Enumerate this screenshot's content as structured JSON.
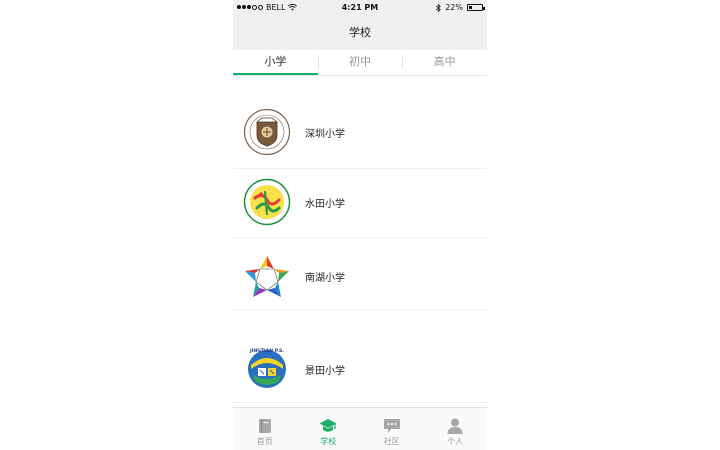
{
  "status_bar": {
    "carrier": "BELL",
    "time": "4:21 PM",
    "battery": "22%",
    "battery_level": 0.22,
    "signal_bars": 3
  },
  "nav": {
    "title": "学校"
  },
  "tabs": [
    {
      "label": "小学",
      "active": true
    },
    {
      "label": "初中",
      "active": false
    },
    {
      "label": "高中",
      "active": false
    }
  ],
  "schools": [
    {
      "name": "深圳小学",
      "logo": "shenzhen-school-crest-logo"
    },
    {
      "name": "水田小学",
      "logo": "shuitian-school-circle-logo"
    },
    {
      "name": "南湖小学",
      "logo": "nanhu-school-star-logo"
    },
    {
      "name": "景田小学",
      "logo": "jingtian-school-logo",
      "logo_text": "JINGTIAN P.S."
    }
  ],
  "tab_bar": [
    {
      "label": "首页",
      "icon": "book-icon",
      "active": false
    },
    {
      "label": "学校",
      "icon": "graduation-cap-icon",
      "active": true
    },
    {
      "label": "社区",
      "icon": "chat-bubble-icon",
      "active": false
    },
    {
      "label": "个人",
      "icon": "person-icon",
      "active": false
    }
  ],
  "colors": {
    "accent": "#1aad6e",
    "inactive": "#999999",
    "bar_bg": "#f0f0f0"
  }
}
